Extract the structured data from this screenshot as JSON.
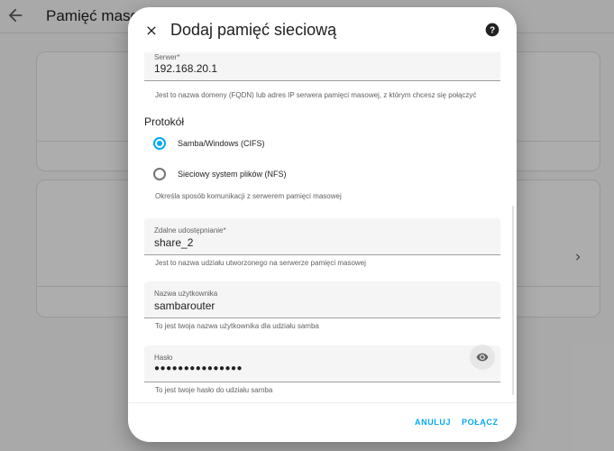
{
  "background": {
    "title": "Pamięć masowa"
  },
  "dialog": {
    "title": "Dodaj pamięć sieciową",
    "server": {
      "label": "Serwer*",
      "value": "192.168.20.1",
      "helper": "Jest to nazwa domeny (FQDN) lub adres IP serwera pamięci masowej, z którym chcesz się połączyć"
    },
    "protocol": {
      "title": "Protokół",
      "options": [
        "Samba/Windows (CIFS)",
        "Sieciowy system plików (NFS)"
      ],
      "selected": "Samba/Windows (CIFS)",
      "helper": "Określa sposób komunikacji z serwerem pamięci masowej"
    },
    "share": {
      "label": "Zdalne udostępnianie*",
      "value": "share_2",
      "helper": "Jest to nazwa udziału utworzonego na serwerze pamięci masowej"
    },
    "username": {
      "label": "Nazwa użytkownika",
      "value": "sambarouter",
      "helper": "To jest twoja nazwa użytkownika dla udziału samba"
    },
    "password": {
      "label": "Hasło",
      "value": "●●●●●●●●●●●●●●●",
      "helper": "To jest twoje hasło do udziału samba"
    },
    "actions": {
      "cancel": "ANULUJ",
      "connect": "POŁĄCZ"
    }
  },
  "colors": {
    "accent": "#03a9f4",
    "scrim": "rgba(0,0,0,0.32)"
  },
  "icons": [
    "back-arrow-icon",
    "close-icon",
    "help-icon",
    "eye-icon",
    "chevron-right-icon"
  ]
}
